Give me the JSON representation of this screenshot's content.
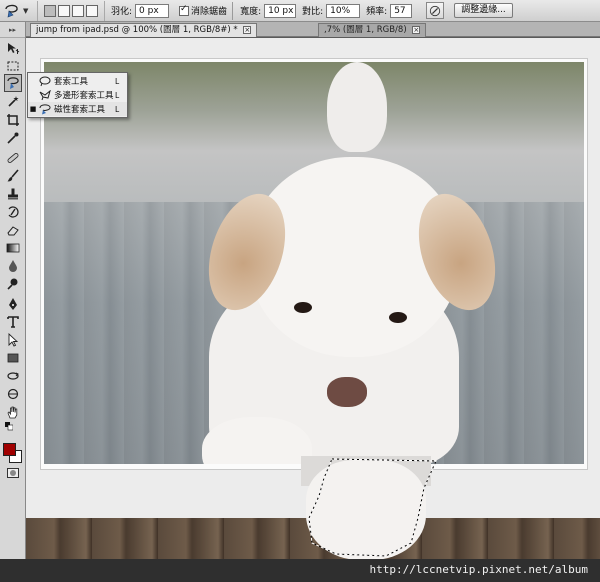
{
  "options_bar": {
    "feather_label": "羽化:",
    "feather_value": "0 px",
    "antialias_label": "消除鋸齒",
    "width_label": "寬度:",
    "width_value": "10 px",
    "contrast_label": "對比:",
    "contrast_value": "10%",
    "frequency_label": "頻率:",
    "frequency_value": "57",
    "refine_edge_label": "調整邊緣..."
  },
  "tabs": {
    "active": "jump from ipad.psd @ 100% (圖層 1, RGB/8#) *",
    "inactive": ",7% (圖層 1, RGB/8)"
  },
  "flyout": {
    "items": [
      {
        "label": "套索工具",
        "key": "L",
        "icon": "lasso-icon"
      },
      {
        "label": "多邊形套索工具",
        "key": "L",
        "icon": "polygonal-lasso-icon"
      },
      {
        "label": "磁性套索工具",
        "key": "L",
        "icon": "magnetic-lasso-icon",
        "bullet": "■"
      }
    ]
  },
  "colors": {
    "foreground": "#a00000",
    "background": "#ffffff"
  },
  "watermark": "http://lccnetvip.pixnet.net/album"
}
